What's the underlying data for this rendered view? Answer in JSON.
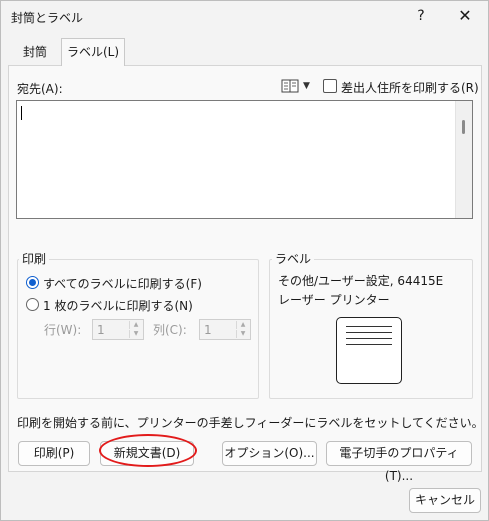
{
  "window": {
    "title": "封筒とラベル",
    "help_glyph": "?",
    "close_glyph": "✕"
  },
  "tabs": [
    {
      "label": "封筒",
      "active": false
    },
    {
      "label": "ラベル(L)",
      "active": true
    }
  ],
  "address": {
    "label": "宛先(A):",
    "value": "",
    "return_address_checkbox": {
      "label": "差出人住所を印刷する(R)",
      "checked": false
    }
  },
  "print_group": {
    "caption": "印刷",
    "options": [
      {
        "label": "すべてのラベルに印刷する(F)",
        "selected": true
      },
      {
        "label": "1 枚のラベルに印刷する(N)",
        "selected": false
      }
    ],
    "row_label": "行(W):",
    "row_value": "1",
    "column_label": "列(C):",
    "column_value": "1"
  },
  "label_group": {
    "caption": "ラベル",
    "description_line1": "その他/ユーザー設定, 64415E",
    "description_line2": "レーザー プリンター"
  },
  "instruction": "印刷を開始する前に、プリンターの手差しフィーダーにラベルをセットしてください。",
  "buttons": {
    "print": "印刷(P)",
    "new_document": "新規文書(D)",
    "options": "オプション(O)...",
    "postage_properties": "電子切手のプロパティ(T)...",
    "cancel": "キャンセル"
  },
  "colors": {
    "accent": "#0f5fcf",
    "highlight": "#e21b1b"
  },
  "icons": {
    "address_book": "address-book-icon",
    "dropdown": "chevron-down-icon"
  }
}
